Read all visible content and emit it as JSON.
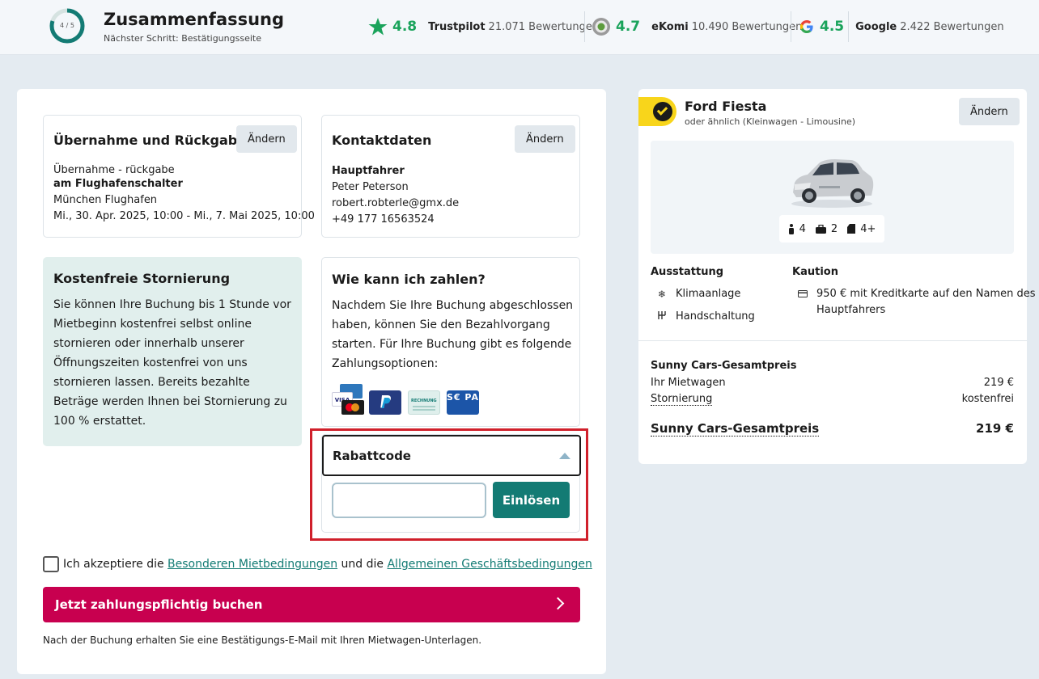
{
  "header": {
    "progress_text": "4 / 5",
    "progress_fraction": 0.8,
    "title": "Zusammenfassung",
    "subtitle": "Nächster Schritt: Bestätigungsseite",
    "ratings": [
      {
        "score": "4.8",
        "brand": "Trustpilot",
        "count": "21.071 Bewertungen",
        "icon": "trustpilot-star-icon"
      },
      {
        "score": "4.7",
        "brand": "eKomi",
        "count": "10.490 Bewertungen",
        "icon": "ekomi-seal-icon"
      },
      {
        "score": "4.5",
        "brand": "Google",
        "count": "2.422 Bewertungen",
        "icon": "google-g-icon"
      }
    ]
  },
  "pickup": {
    "title": "Übernahme und Rückgabe",
    "button": "Ändern",
    "label": "Übernahme - rückgabe",
    "location_type": "am Flughafenschalter",
    "location": "München Flughafen",
    "dates": "Mi., 30. Apr. 2025, 10:00 - Mi., 7. Mai 2025, 10:00"
  },
  "contact": {
    "title": "Kontaktdaten",
    "button": "Ändern",
    "label": "Hauptfahrer",
    "name": "Peter Peterson",
    "email": "robert.robterle@gmx.de",
    "phone": "+49 177 16563524"
  },
  "cancellation": {
    "title": "Kostenfreie Stornierung",
    "text": "Sie können Ihre Buchung bis 1 Stunde vor Mietbeginn kostenfrei selbst online stornieren oder innerhalb unserer Öffnungszeiten kostenfrei von uns stornieren lassen. Bereits bezahlte Beträge werden Ihnen bei Stornierung zu 100 % erstattet."
  },
  "payment": {
    "title": "Wie kann ich zahlen?",
    "text": "Nachdem Sie Ihre Buchung abgeschlossen haben, können Sie den Bezahlvorgang starten. Für Ihre Buchung gibt es folgende Zahlungsoptionen:",
    "methods": [
      "card-icons",
      "paypal-icon",
      "rechnung-icon",
      "sepa-icon"
    ],
    "visa_text": "VISA",
    "rechnung_text": "RECHNUNG",
    "sepa_text": "S€ PA"
  },
  "discount": {
    "title": "Rabattcode",
    "input_value": "",
    "input_placeholder": "",
    "button": "Einlösen"
  },
  "terms": {
    "prefix": "Ich akzeptiere die",
    "link1": "Besonderen Mietbedingungen",
    "middle": "und die",
    "link2": "Allgemeinen Geschäftsbedingungen",
    "checked": false
  },
  "book_button": "Jetzt zahlungspflichtig buchen",
  "footnote": "Nach der Buchung erhalten Sie eine Bestätigungs-E-Mail mit Ihren Mietwagen-Unterlagen.",
  "car": {
    "name": "Ford Fiesta",
    "subtitle": "oder ähnlich  (Kleinwagen - Limousine)",
    "button": "Ändern",
    "seats": "4",
    "bags": "2",
    "doors": "4+",
    "equipment_title": "Ausstattung",
    "equipment": [
      "Klimaanlage",
      "Handschaltung"
    ],
    "deposit_title": "Kaution",
    "deposit_line1": "950 € mit Kreditkarte auf den Namen des",
    "deposit_line2": "Hauptfahrers"
  },
  "price": {
    "section_title": "Sunny Cars-Gesamtpreis",
    "rental_label": "Ihr Mietwagen",
    "rental_value": "219 €",
    "cancel_label": "Stornierung",
    "cancel_value": "kostenfrei",
    "total_label": "Sunny Cars-Gesamtpreis",
    "total_value": "219 €"
  },
  "colors": {
    "accent_green": "#1aa35b",
    "teal": "#137b74",
    "book_button": "#c8004f",
    "highlight_border": "#d0202b",
    "selected_tab": "#f8d51b"
  }
}
